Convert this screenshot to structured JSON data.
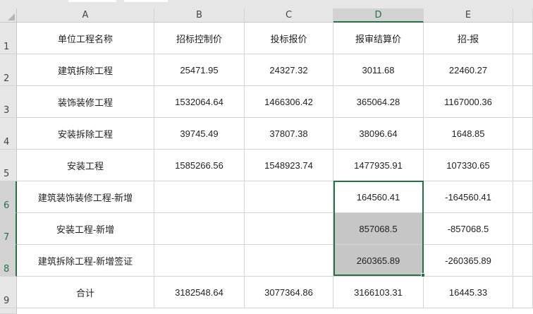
{
  "columns": [
    {
      "letter": "A",
      "selected": false
    },
    {
      "letter": "B",
      "selected": false
    },
    {
      "letter": "C",
      "selected": false
    },
    {
      "letter": "D",
      "selected": true
    },
    {
      "letter": "E",
      "selected": false
    }
  ],
  "rows": [
    {
      "number": "1",
      "selected": false,
      "cells": [
        "单位工程名称",
        "招标控制价",
        "投标报价",
        "报审结算价",
        "招-报"
      ]
    },
    {
      "number": "2",
      "selected": false,
      "cells": [
        "建筑拆除工程",
        "25471.95",
        "24327.32",
        "3011.68",
        "22460.27"
      ]
    },
    {
      "number": "3",
      "selected": false,
      "cells": [
        "装饰装修工程",
        "1532064.64",
        "1466306.42",
        "365064.28",
        "1167000.36"
      ]
    },
    {
      "number": "4",
      "selected": false,
      "cells": [
        "安装拆除工程",
        "39745.49",
        "37807.38",
        "38096.64",
        "1648.85"
      ]
    },
    {
      "number": "5",
      "selected": false,
      "cells": [
        "安装工程",
        "1585266.56",
        "1548923.74",
        "1477935.91",
        "107330.65"
      ]
    },
    {
      "number": "6",
      "selected": true,
      "cells": [
        "建筑装饰装修工程-新增",
        "",
        "",
        "164560.41",
        "-164560.41"
      ]
    },
    {
      "number": "7",
      "selected": true,
      "cells": [
        "安装工程-新增",
        "",
        "",
        "857068.5",
        "-857068.5"
      ]
    },
    {
      "number": "8",
      "selected": true,
      "cells": [
        "建筑拆除工程-新增签证",
        "",
        "",
        "260365.89",
        "-260365.89"
      ]
    },
    {
      "number": "9",
      "selected": false,
      "cells": [
        "合计",
        "3182548.64",
        "3077364.86",
        "3166103.31",
        "16445.33"
      ]
    }
  ],
  "selection": {
    "range": "D6:D8",
    "active_cell": "D6"
  },
  "colors": {
    "selection_border": "#217346",
    "header_bg": "#e6e6e6",
    "selected_header_bg": "#d2d2d2",
    "shaded_cell": "#c6c6c6"
  }
}
